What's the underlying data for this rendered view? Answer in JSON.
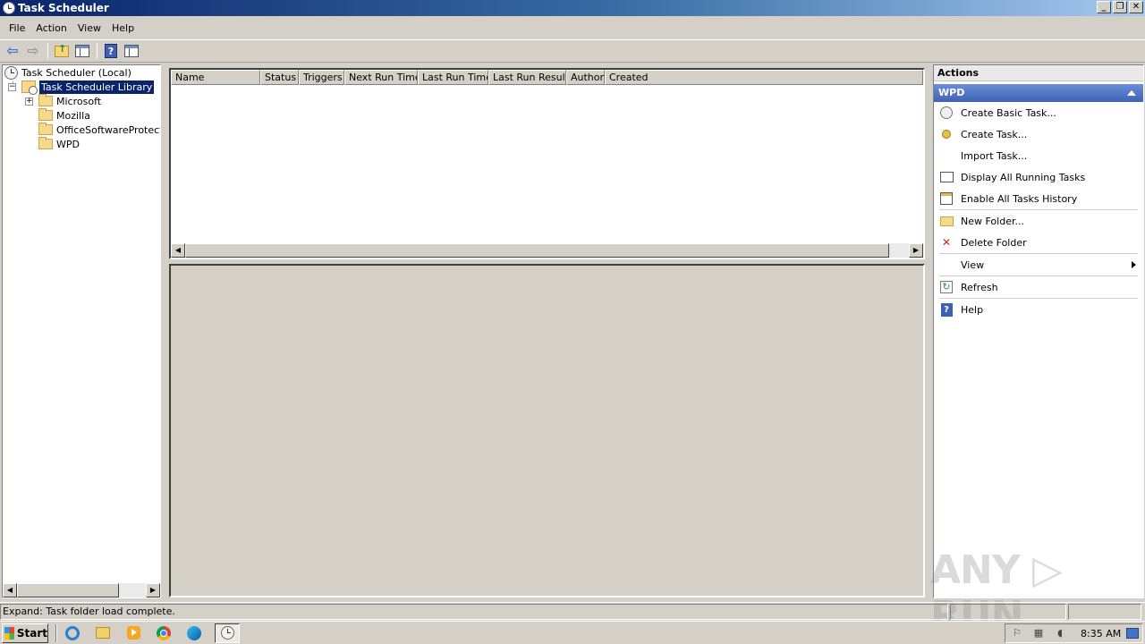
{
  "window": {
    "title": "Task Scheduler",
    "controls": {
      "minimize": "_",
      "maximize": "❐",
      "close": "✕"
    }
  },
  "menu": {
    "items": [
      "File",
      "Action",
      "View",
      "Help"
    ]
  },
  "toolbar": {
    "icons": [
      "back-arrow-icon",
      "forward-arrow-icon",
      "folder-up-icon",
      "show-hide-pane-icon",
      "help-icon",
      "action-pane-icon"
    ]
  },
  "tree": {
    "root": "Task Scheduler (Local)",
    "library": "Task Scheduler Library",
    "expand_symbol": "−",
    "collapsed_symbol": "+",
    "folders": [
      "Microsoft",
      "Mozilla",
      "OfficeSoftwareProtectio",
      "WPD"
    ]
  },
  "list": {
    "columns": [
      "Name",
      "Status",
      "Triggers",
      "Next Run Time",
      "Last Run Time",
      "Last Run Result",
      "Author",
      "Created"
    ]
  },
  "actions": {
    "header": "Actions",
    "group": "WPD",
    "items": {
      "create_basic": "Create Basic Task...",
      "create_task": "Create Task...",
      "import_task": "Import Task...",
      "display_running": "Display All Running Tasks",
      "enable_history": "Enable All Tasks History",
      "new_folder": "New Folder...",
      "delete_folder": "Delete Folder",
      "view": "View",
      "refresh": "Refresh",
      "help": "Help"
    }
  },
  "status": {
    "text": "Expand:  Task folder load complete."
  },
  "watermark": "ANY ▷ RUN",
  "taskbar": {
    "start": "Start",
    "clock": "8:35 AM"
  },
  "colors": {
    "selection": "#0a246a",
    "actions_group": "#3f62b4",
    "face": "#d4d0c8"
  }
}
